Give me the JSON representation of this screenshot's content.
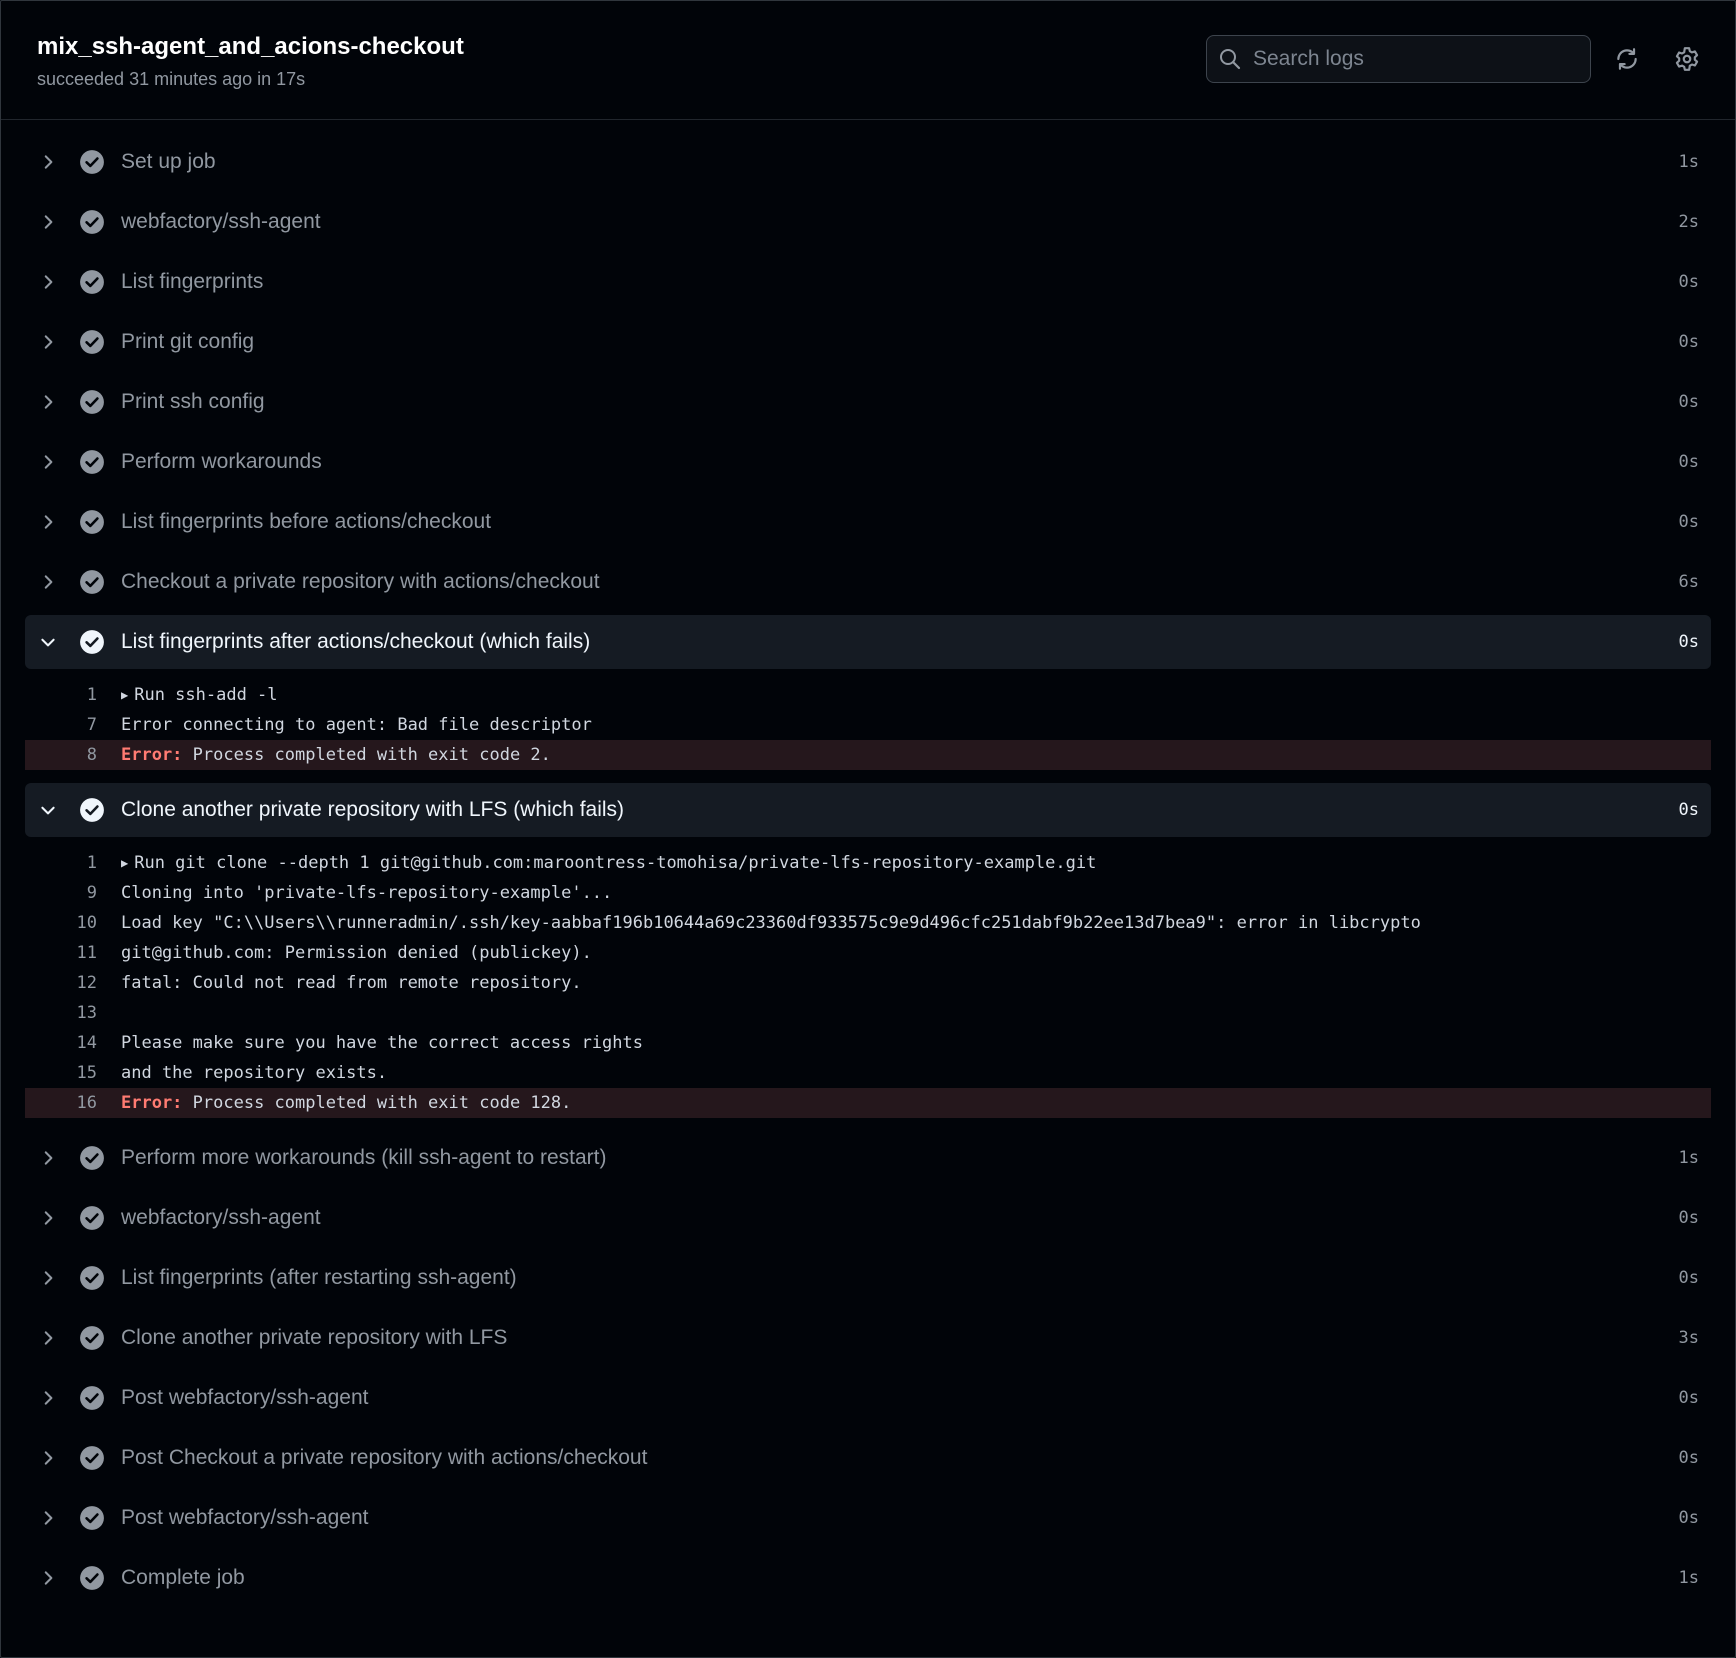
{
  "header": {
    "title": "mix_ssh-agent_and_acions-checkout",
    "subtitle": "succeeded 31 minutes ago in 17s",
    "search_placeholder": "Search logs"
  },
  "steps_before": [
    {
      "label": "Set up job",
      "duration": "1s"
    },
    {
      "label": "webfactory/ssh-agent",
      "duration": "2s"
    },
    {
      "label": "List fingerprints",
      "duration": "0s"
    },
    {
      "label": "Print git config",
      "duration": "0s"
    },
    {
      "label": "Print ssh config",
      "duration": "0s"
    },
    {
      "label": "Perform workarounds",
      "duration": "0s"
    },
    {
      "label": "List fingerprints before actions/checkout",
      "duration": "0s"
    },
    {
      "label": "Checkout a private repository with actions/checkout",
      "duration": "6s"
    }
  ],
  "open_step_1": {
    "label": "List fingerprints after actions/checkout (which fails)",
    "duration": "0s",
    "lines": [
      {
        "num": "1",
        "text": "Run ssh-add -l"
      },
      {
        "num": "7",
        "text": "Error connecting to agent: Bad file descriptor"
      },
      {
        "num": "8",
        "error_label": "Error:",
        "text": " Process completed with exit code 2."
      }
    ]
  },
  "open_step_2": {
    "label": "Clone another private repository with LFS (which fails)",
    "duration": "0s",
    "lines": [
      {
        "num": "1",
        "text": "Run git clone --depth 1 git@github.com:maroontress-tomohisa/private-lfs-repository-example.git"
      },
      {
        "num": "9",
        "text": "Cloning into 'private-lfs-repository-example'..."
      },
      {
        "num": "10",
        "text": "Load key \"C:\\\\Users\\\\runneradmin/.ssh/key-aabbaf196b10644a69c23360df933575c9e9d496cfc251dabf9b22ee13d7bea9\": error in libcrypto"
      },
      {
        "num": "11",
        "text": "git@github.com: Permission denied (publickey)."
      },
      {
        "num": "12",
        "text": "fatal: Could not read from remote repository."
      },
      {
        "num": "13",
        "text": ""
      },
      {
        "num": "14",
        "text": "Please make sure you have the correct access rights"
      },
      {
        "num": "15",
        "text": "and the repository exists."
      },
      {
        "num": "16",
        "error_label": "Error:",
        "text": " Process completed with exit code 128."
      }
    ]
  },
  "steps_after": [
    {
      "label": "Perform more workarounds (kill ssh-agent to restart)",
      "duration": "1s"
    },
    {
      "label": "webfactory/ssh-agent",
      "duration": "0s"
    },
    {
      "label": "List fingerprints (after restarting ssh-agent)",
      "duration": "0s"
    },
    {
      "label": "Clone another private repository with LFS",
      "duration": "3s"
    },
    {
      "label": "Post webfactory/ssh-agent",
      "duration": "0s"
    },
    {
      "label": "Post Checkout a private repository with actions/checkout",
      "duration": "0s"
    },
    {
      "label": "Post webfactory/ssh-agent",
      "duration": "0s"
    },
    {
      "label": "Complete job",
      "duration": "1s"
    }
  ],
  "icons": {
    "search": "search-icon",
    "refresh": "sync-icon",
    "settings": "gear-icon",
    "expand_collapsed": "chevron-right-icon",
    "expand_open": "chevron-down-icon",
    "status": "check-circle-icon",
    "group": "triangle-right-icon"
  },
  "colors": {
    "background": "#010409",
    "error_text": "#ff7b72",
    "error_row": "#25171c",
    "open_step_bg": "#151b23"
  }
}
